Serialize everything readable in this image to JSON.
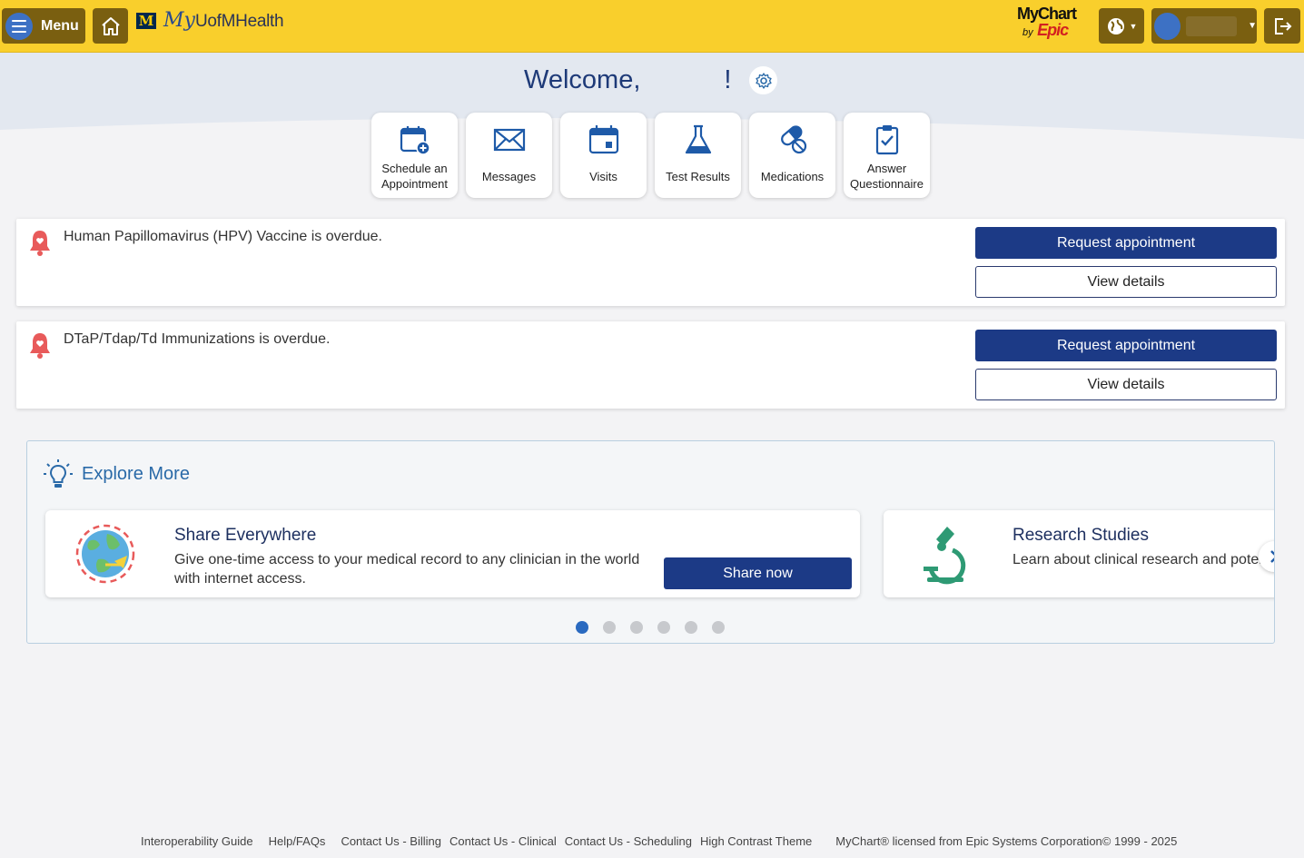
{
  "header": {
    "menu_label": "Menu",
    "logo_m": "M",
    "logo_my": "My",
    "logo_rest": "UofMHealth",
    "mychart_text": "MyChart",
    "by_text": "by",
    "epic_text": "Epic"
  },
  "welcome": {
    "greeting": "Welcome,",
    "exclaim": "!"
  },
  "tiles": [
    {
      "label": "Schedule an Appointment",
      "icon": "calendar-plus-icon"
    },
    {
      "label": "Messages",
      "icon": "envelope-icon"
    },
    {
      "label": "Visits",
      "icon": "calendar-icon"
    },
    {
      "label": "Test Results",
      "icon": "flask-icon"
    },
    {
      "label": "Medications",
      "icon": "pills-icon"
    },
    {
      "label": "Answer Questionnaire",
      "icon": "clipboard-check-icon"
    }
  ],
  "alerts": [
    {
      "message": "Human Papillomavirus (HPV) Vaccine is overdue.",
      "primary": "Request appointment",
      "secondary": "View details"
    },
    {
      "message": "DTaP/Tdap/Td Immunizations is overdue.",
      "primary": "Request appointment",
      "secondary": "View details"
    }
  ],
  "explore": {
    "title": "Explore More",
    "cards": [
      {
        "title": "Share Everywhere",
        "desc_line1": "Give one-time access to your medical record to any clinician in the world",
        "desc_line2": "with internet access.",
        "button": "Share now"
      },
      {
        "title": "Research Studies",
        "desc": "Learn about clinical research and potential studies"
      }
    ],
    "dots_total": 6,
    "dots_active": 1
  },
  "footer": {
    "links": [
      "Interoperability Guide",
      "Help/FAQs",
      "Contact Us - Billing",
      "Contact Us - Clinical",
      "Contact Us - Scheduling",
      "High Contrast Theme"
    ],
    "license": "MyChart® licensed from Epic Systems Corporation© 1999 - 2025"
  },
  "colors": {
    "header_bg": "#f9cf2c",
    "header_button": "#7a5f10",
    "primary": "#1c3a86",
    "accent_blue": "#2a6aa8",
    "alert_bell": "#e85a5a"
  }
}
